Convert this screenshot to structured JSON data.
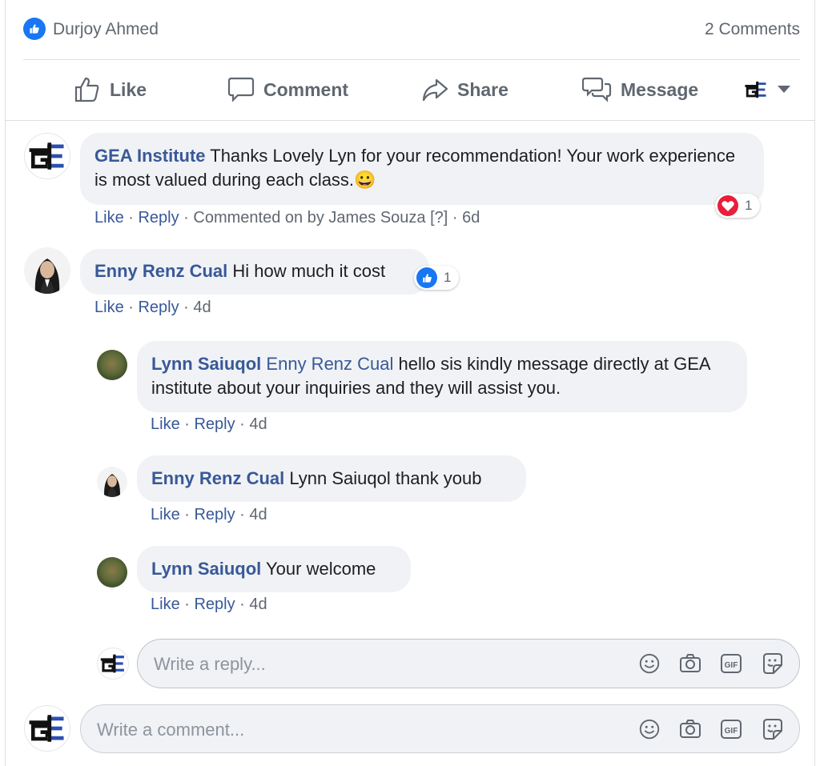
{
  "summary": {
    "reactor_name": "Durjoy Ahmed",
    "comment_count": "2 Comments"
  },
  "actions": {
    "like": "Like",
    "comment": "Comment",
    "share": "Share",
    "message": "Message"
  },
  "comments": [
    {
      "author": "GEA Institute",
      "text": "Thanks Lovely Lyn for your recommendation! Your work experience is most valued during each class.",
      "emoji": "😀",
      "reaction": {
        "type": "love",
        "count": "1",
        "color": "#e81e3a"
      },
      "meta": {
        "like": "Like",
        "reply": "Reply",
        "commented_on_by": "Commented on by James Souza [?]",
        "time": "6d"
      }
    },
    {
      "author": "Enny Renz Cual",
      "text": "Hi how much it cost",
      "reaction": {
        "type": "like",
        "count": "1",
        "color": "#1877f2"
      },
      "meta": {
        "like": "Like",
        "reply": "Reply",
        "time": "4d"
      },
      "replies": [
        {
          "author": "Lynn Saiuqol",
          "mention": "Enny Renz Cual",
          "text": "hello sis kindly message directly at GEA institute about your inquiries and they will assist you.",
          "meta": {
            "like": "Like",
            "reply": "Reply",
            "time": "4d"
          }
        },
        {
          "author": "Enny Renz Cual",
          "text": "Lynn Saiuqol thank youb",
          "meta": {
            "like": "Like",
            "reply": "Reply",
            "time": "4d"
          }
        },
        {
          "author": "Lynn Saiuqol",
          "text": "Your welcome",
          "meta": {
            "like": "Like",
            "reply": "Reply",
            "time": "4d"
          }
        }
      ]
    }
  ],
  "reply_composer": {
    "placeholder": "Write a reply..."
  },
  "comment_composer": {
    "placeholder": "Write a comment..."
  },
  "colors": {
    "link": "#385898",
    "brand": "#1877f2",
    "bubble": "#f0f2f5",
    "meta": "#606770"
  }
}
